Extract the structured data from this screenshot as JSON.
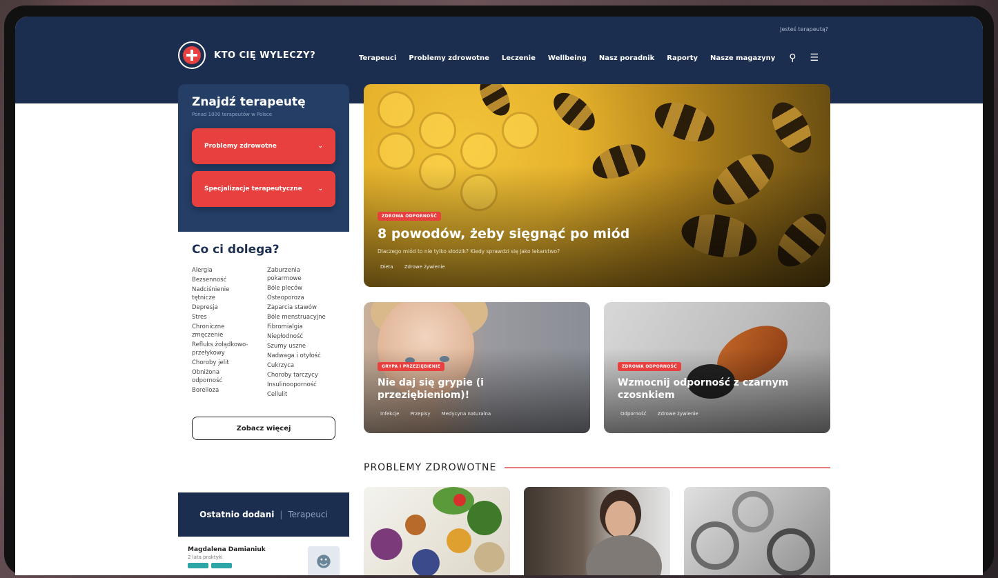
{
  "header": {
    "top_link": "Jesteś terapeutą?",
    "logo_text": "KTO CIĘ WYLECZY?",
    "nav": [
      "Terapeuci",
      "Problemy zdrowotne",
      "Leczenie",
      "Wellbeing",
      "Nasz poradnik",
      "Raporty",
      "Nasze magazyny"
    ],
    "search_icon": "search-icon",
    "menu_icon": "hamburger-icon"
  },
  "finder": {
    "title": "Znajdź terapeutę",
    "subtitle": "Ponad 1000 terapeutów w Polsce",
    "btn_health": "Problemy zdrowotne",
    "btn_spec": "Specjalizacje terapeutyczne"
  },
  "ailments": {
    "title": "Co ci dolega?",
    "col1": [
      "Alergia",
      "Bezsenność",
      "Nadciśnienie",
      "tętnicze",
      "Depresja",
      "Stres",
      "Chroniczne",
      "zmęczenie",
      "Refluks żołądkowo-",
      "przełykowy",
      "Choroby jelit",
      "Obniżona",
      "odporność",
      "Borelioza"
    ],
    "col2": [
      "Zaburzenia",
      "pokarmowe",
      "Bóle pleców",
      "Osteoporoza",
      "Zaparcia stawów",
      "Bóle menstruacyjne",
      "Fibromialgia",
      "Niepłodność",
      "Szumy uszne",
      "Nadwaga i otyłość",
      "Cukrzyca",
      "Choroby tarczycy",
      "Insulinooporność",
      "Cellulit"
    ],
    "more_btn": "Zobacz więcej"
  },
  "recent": {
    "main": "Ostatnio dodani",
    "sub": "Terapeuci"
  },
  "person": {
    "name": "Magdalena Damianiuk",
    "sub": "2 lata praktyki"
  },
  "hero": {
    "badge": "ZDROWA ODPORNOŚĆ",
    "title": "8 powodów, żeby sięgnąć po miód",
    "desc": "Dlaczego miód to nie tylko słodzik? Kiedy sprawdzi się jako lekarstwo?",
    "chips": [
      "Dieta",
      "Zdrowe żywienie"
    ]
  },
  "card1": {
    "badge": "GRYPA I PRZEZIĘBIENIE",
    "title": "Nie daj się grypie (i przeziębieniom)!",
    "chips": [
      "Infekcje",
      "Przepisy",
      "Medycyna naturalna"
    ]
  },
  "card2": {
    "badge": "ZDROWA ODPORNOŚĆ",
    "title": "Wzmocnij odporność z czarnym czosnkiem",
    "chips": [
      "Odporność",
      "Zdrowe żywienie"
    ]
  },
  "section": {
    "title": "PROBLEMY ZDROWOTNE"
  },
  "colors": {
    "navy": "#1c2e4f",
    "panel": "#243e66",
    "accent_red": "#e8403f",
    "teal": "#2ea6a8"
  }
}
